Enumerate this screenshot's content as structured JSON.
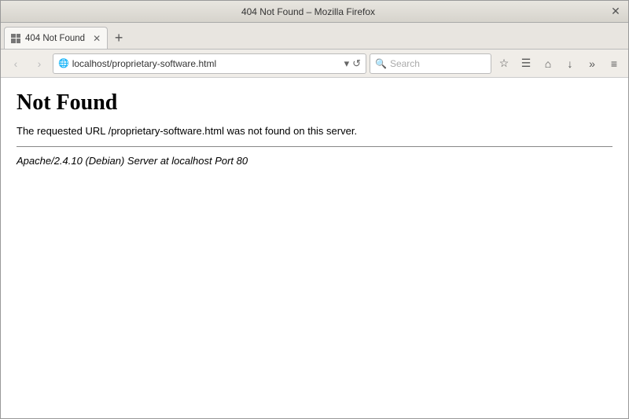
{
  "window": {
    "title": "404 Not Found – Mozilla Firefox",
    "close_label": "✕"
  },
  "tab": {
    "label": "404 Not Found",
    "close_symbol": "✕",
    "new_tab_symbol": "+"
  },
  "navbar": {
    "back_symbol": "‹",
    "forward_symbol": "›",
    "address": "localhost/proprietary-software.html",
    "address_placeholder": "localhost/proprietary-software.html",
    "reload_symbol": "↺",
    "search_placeholder": "Search",
    "bookmark_symbol": "☆",
    "reader_symbol": "☰",
    "home_symbol": "⌂",
    "download_symbol": "↓",
    "overflow_symbol": "»",
    "menu_symbol": "≡"
  },
  "content": {
    "heading": "Not Found",
    "message": "The requested URL /proprietary-software.html was not found on this server.",
    "footer": "Apache/2.4.10 (Debian) Server at localhost Port 80"
  }
}
